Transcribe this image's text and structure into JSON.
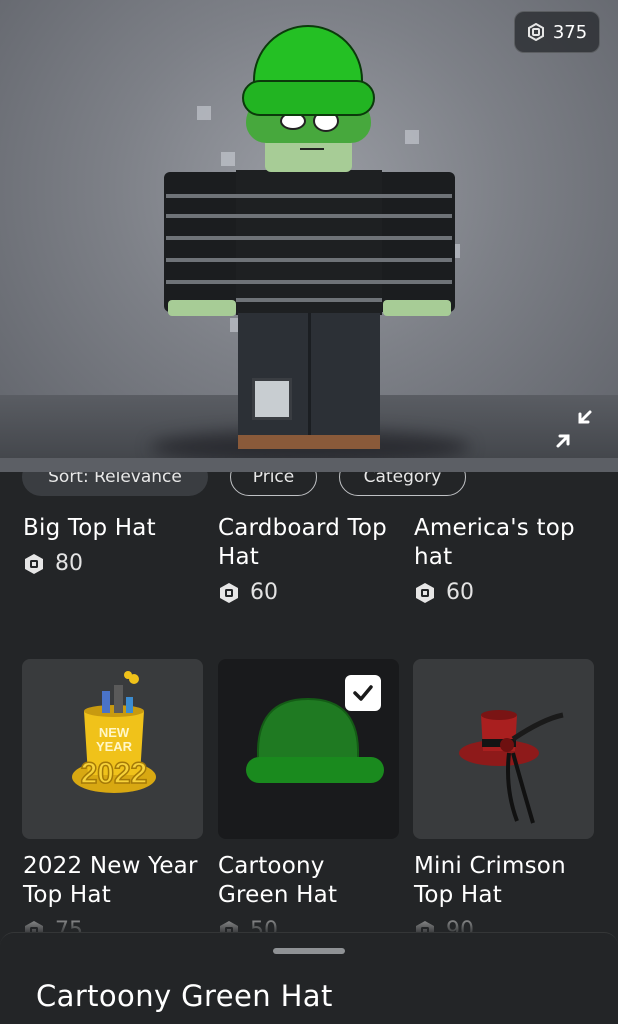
{
  "header": {
    "robux_balance": "375",
    "robux_icon": "robux-icon",
    "expand_icon": "collapse-expand-arrows-icon"
  },
  "filters": {
    "sort_label": "Sort: Relevance",
    "price_label": "Price",
    "category_label": "Category"
  },
  "items_row1": [
    {
      "name": "Big Top Hat",
      "price": "80"
    },
    {
      "name": "Cardboard Top Hat",
      "price": "60"
    },
    {
      "name": "America's top hat",
      "price": "60"
    }
  ],
  "items_row2": [
    {
      "name": "2022 New Year Top Hat",
      "price": "75",
      "selected": false
    },
    {
      "name": "Cartoony Green Hat",
      "price": "50",
      "selected": true
    },
    {
      "name": "Mini Crimson Top Hat",
      "price": "90",
      "selected": false
    }
  ],
  "sheet": {
    "title": "Cartoony Green Hat"
  },
  "colors": {
    "background": "#232527",
    "card": "#393b3d",
    "accent_green": "#24c024"
  }
}
